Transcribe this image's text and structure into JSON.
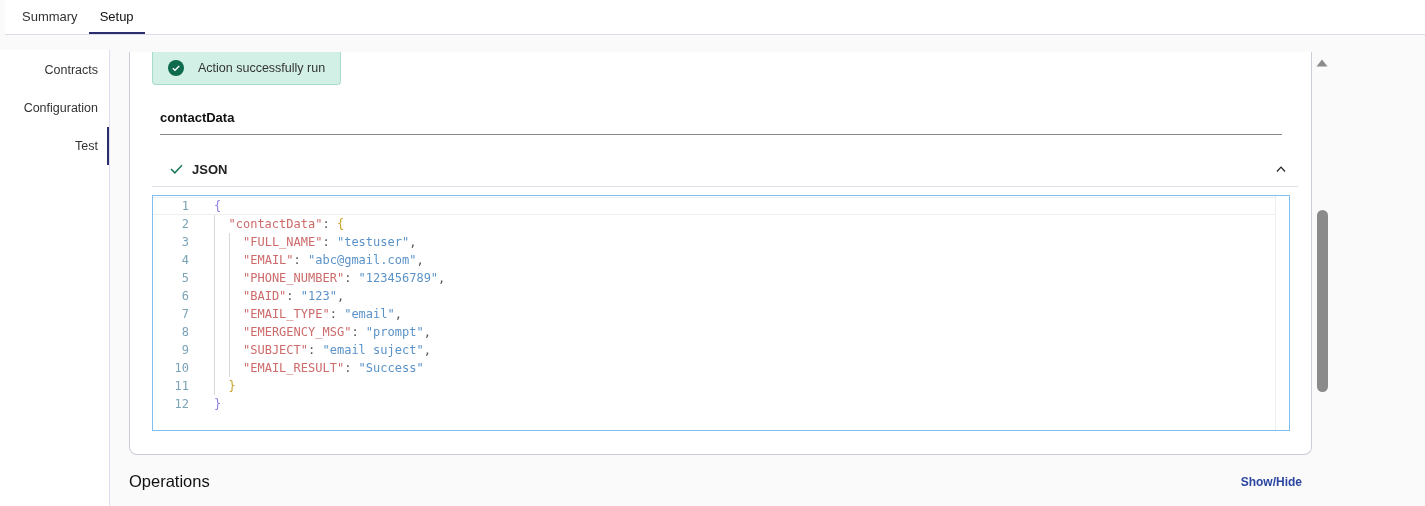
{
  "tabs": [
    {
      "label": "Summary",
      "selected": false
    },
    {
      "label": "Setup",
      "selected": true
    }
  ],
  "sidebar": {
    "items": [
      {
        "label": "Contracts",
        "selected": false
      },
      {
        "label": "Configuration",
        "selected": false
      },
      {
        "label": "Test",
        "selected": true
      }
    ]
  },
  "alert": {
    "text": "Action successfully run"
  },
  "field": {
    "label": "contactData"
  },
  "accordion": {
    "title": "JSON",
    "expanded": true
  },
  "editor": {
    "lines": [
      {
        "number": "1",
        "parts": [
          {
            "kind": "brace1",
            "text": "{"
          }
        ],
        "children": [
          {
            "number": "2",
            "parts": [
              {
                "kind": "key",
                "text": "\"contactData\""
              },
              {
                "kind": "punct",
                "text": ": "
              },
              {
                "kind": "brace2",
                "text": "{"
              }
            ],
            "children": [
              {
                "number": "3",
                "parts": [
                  {
                    "kind": "key",
                    "text": "\"FULL_NAME\""
                  },
                  {
                    "kind": "punct",
                    "text": ": "
                  },
                  {
                    "kind": "string",
                    "text": "\"testuser\""
                  },
                  {
                    "kind": "punct",
                    "text": ","
                  }
                ]
              },
              {
                "number": "4",
                "parts": [
                  {
                    "kind": "key",
                    "text": "\"EMAIL\""
                  },
                  {
                    "kind": "punct",
                    "text": ": "
                  },
                  {
                    "kind": "string",
                    "text": "\"abc@gmail.com\""
                  },
                  {
                    "kind": "punct",
                    "text": ","
                  }
                ]
              },
              {
                "number": "5",
                "parts": [
                  {
                    "kind": "key",
                    "text": "\"PHONE_NUMBER\""
                  },
                  {
                    "kind": "punct",
                    "text": ": "
                  },
                  {
                    "kind": "string",
                    "text": "\"123456789\""
                  },
                  {
                    "kind": "punct",
                    "text": ","
                  }
                ]
              },
              {
                "number": "6",
                "parts": [
                  {
                    "kind": "key",
                    "text": "\"BAID\""
                  },
                  {
                    "kind": "punct",
                    "text": ": "
                  },
                  {
                    "kind": "string",
                    "text": "\"123\""
                  },
                  {
                    "kind": "punct",
                    "text": ","
                  }
                ]
              },
              {
                "number": "7",
                "parts": [
                  {
                    "kind": "key",
                    "text": "\"EMAIL_TYPE\""
                  },
                  {
                    "kind": "punct",
                    "text": ": "
                  },
                  {
                    "kind": "string",
                    "text": "\"email\""
                  },
                  {
                    "kind": "punct",
                    "text": ","
                  }
                ]
              },
              {
                "number": "8",
                "parts": [
                  {
                    "kind": "key",
                    "text": "\"EMERGENCY_MSG\""
                  },
                  {
                    "kind": "punct",
                    "text": ": "
                  },
                  {
                    "kind": "string",
                    "text": "\"prompt\""
                  },
                  {
                    "kind": "punct",
                    "text": ","
                  }
                ]
              },
              {
                "number": "9",
                "parts": [
                  {
                    "kind": "key",
                    "text": "\"SUBJECT\""
                  },
                  {
                    "kind": "punct",
                    "text": ": "
                  },
                  {
                    "kind": "string",
                    "text": "\"email suject\""
                  },
                  {
                    "kind": "punct",
                    "text": ","
                  }
                ]
              },
              {
                "number": "10",
                "parts": [
                  {
                    "kind": "key",
                    "text": "\"EMAIL_RESULT\""
                  },
                  {
                    "kind": "punct",
                    "text": ": "
                  },
                  {
                    "kind": "string",
                    "text": "\"Success\""
                  }
                ]
              }
            ]
          },
          {
            "number": "11",
            "parts": [
              {
                "kind": "brace2",
                "text": "}"
              }
            ]
          }
        ]
      },
      {
        "number": "12",
        "parts": [
          {
            "kind": "brace1",
            "text": "}"
          }
        ]
      }
    ]
  },
  "operations": {
    "title": "Operations",
    "toggle": "Show/Hide"
  }
}
